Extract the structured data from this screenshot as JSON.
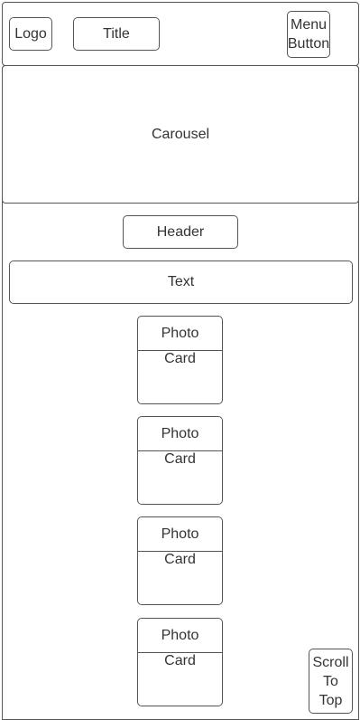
{
  "header": {
    "logo": "Logo",
    "title": "Title",
    "menu_button": "Menu\nButton"
  },
  "carousel": {
    "label": "Carousel"
  },
  "content": {
    "header": "Header",
    "text": "Text"
  },
  "photo_cards": [
    {
      "line1": "Photo",
      "line2": "Card"
    },
    {
      "line1": "Photo",
      "line2": "Card"
    },
    {
      "line1": "Photo",
      "line2": "Card"
    },
    {
      "line1": "Photo",
      "line2": "Card"
    }
  ],
  "scroll_to_top": "Scroll\nTo\nTop"
}
